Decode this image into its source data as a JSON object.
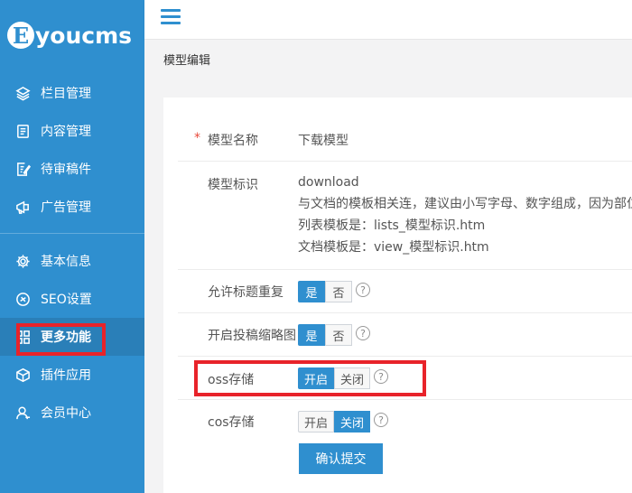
{
  "logo": {
    "mark": "E",
    "text": "youcms"
  },
  "sidebar": {
    "group1": [
      {
        "label": "栏目管理",
        "icon": "layers-icon"
      },
      {
        "label": "内容管理",
        "icon": "document-icon"
      },
      {
        "label": "待审稿件",
        "icon": "edit-document-icon"
      },
      {
        "label": "广告管理",
        "icon": "ad-icon"
      }
    ],
    "group2": [
      {
        "label": "基本信息",
        "icon": "gear-icon"
      },
      {
        "label": "SEO设置",
        "icon": "seo-icon"
      },
      {
        "label": "更多功能",
        "icon": "grid-icon"
      },
      {
        "label": "插件应用",
        "icon": "cube-icon"
      },
      {
        "label": "会员中心",
        "icon": "user-icon"
      }
    ]
  },
  "breadcrumb": "模型编辑",
  "form": {
    "name": {
      "required_mark": "*",
      "label": "模型名称",
      "value": "下载模型"
    },
    "ident": {
      "label": "模型标识",
      "value": "download",
      "hint1": "与文档的模板相关连，建议由小写字母、数字组成，因为部位",
      "hint2": "列表模板是：lists_模型标识.htm",
      "hint3": "文档模板是：view_模型标识.htm"
    },
    "allow_dup_title": {
      "label": "允许标题重复",
      "on": "是",
      "off": "否",
      "selected": "是"
    },
    "thumb": {
      "label": "开启投稿缩略图",
      "on": "是",
      "off": "否",
      "selected": "是"
    },
    "oss": {
      "label": "oss存储",
      "on": "开启",
      "off": "关闭",
      "selected": "开启"
    },
    "cos": {
      "label": "cos存储",
      "on": "开启",
      "off": "关闭",
      "selected": "关闭"
    },
    "help_glyph": "?",
    "submit_label": "确认提交"
  }
}
